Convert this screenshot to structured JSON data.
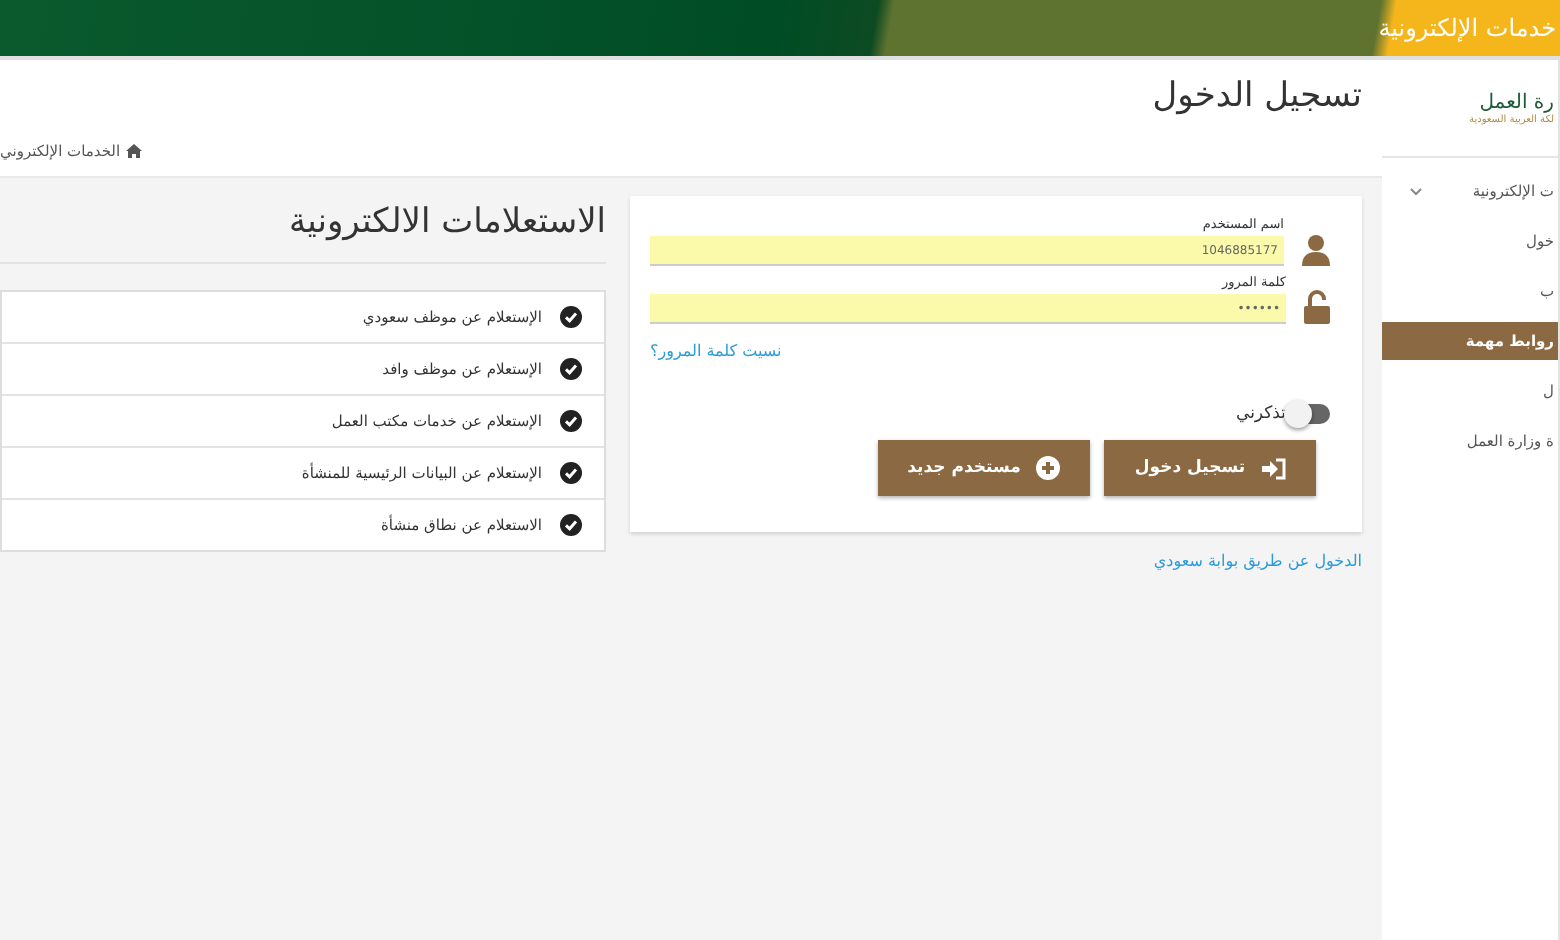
{
  "header": {
    "title": "خدمات الإلكترونية"
  },
  "sidebar": {
    "logo_title": "رة العمل",
    "logo_subtitle": "لكة العربية السعودية",
    "items": [
      {
        "label": "ت الإلكترونية",
        "kind": "group",
        "selected": false
      },
      {
        "label": "خول",
        "kind": "link",
        "selected": false
      },
      {
        "label": "ب",
        "kind": "link",
        "selected": false
      },
      {
        "label": "روابط مهمة",
        "kind": "link",
        "selected": true
      },
      {
        "label": "ل",
        "kind": "link",
        "selected": false
      },
      {
        "label": "ة وزارة العمل",
        "kind": "link",
        "selected": false
      }
    ]
  },
  "page": {
    "title": "تسجيل الدخول",
    "breadcrumb": "الخدمات الإلكتروني"
  },
  "login": {
    "username_label": "اسم المستخدم",
    "username_value": "1046885177",
    "password_label": "كلمة المرور",
    "password_value": "••••••",
    "forgot_link": "نسيت كلمة المرور؟",
    "remember": {
      "label": "تذكرني",
      "on": false
    },
    "buttons": [
      {
        "label": "تسجيل دخول",
        "kind": "login"
      },
      {
        "label": "مستخدم جديد",
        "kind": "register"
      }
    ]
  },
  "alt_login_link": "الدخول عن طريق بوابة سعودي",
  "inquiries": {
    "title": "الاستعلامات الالكترونية",
    "items": [
      "الإستعلام عن موظف سعودي",
      "الإستعلام عن موظف وافد",
      "الإستعلام عن خدمات مكتب العمل",
      "الإستعلام عن البيانات الرئيسية للمنشأة",
      "الاستعلام عن نطاق منشأة"
    ]
  }
}
